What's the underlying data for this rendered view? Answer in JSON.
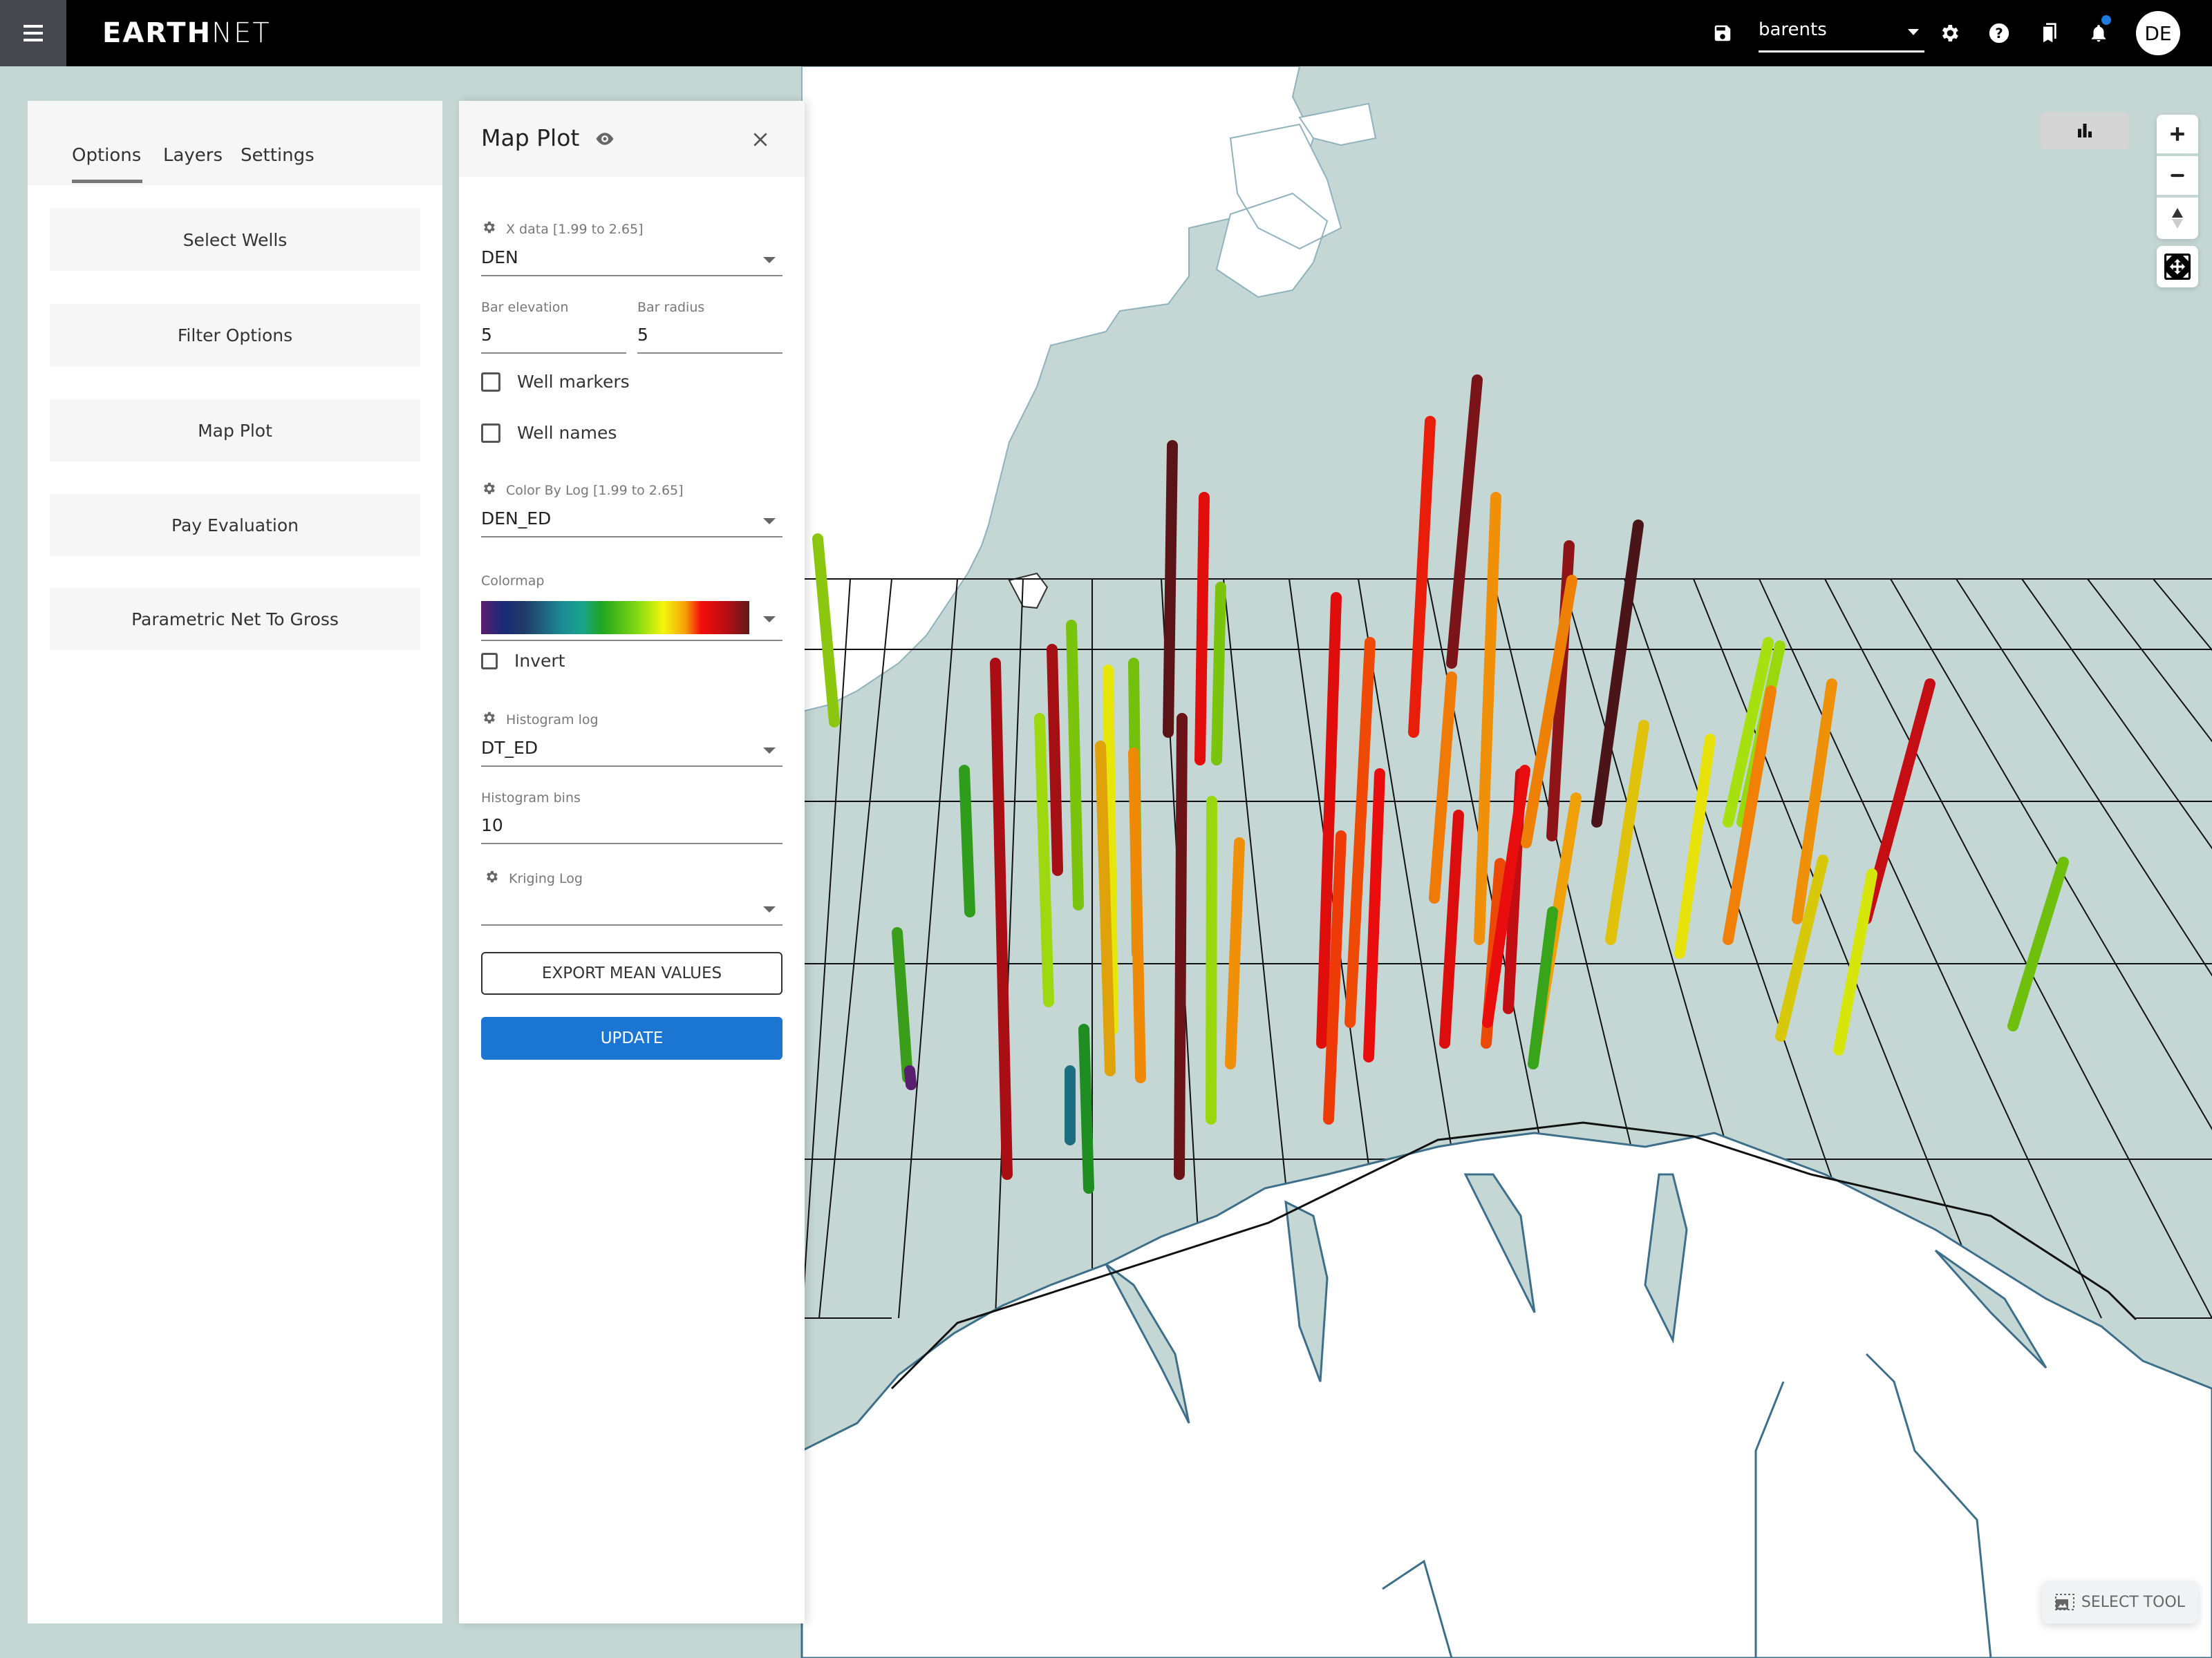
{
  "app": {
    "logo_bold": "EARTH",
    "logo_light": "NET"
  },
  "topbar": {
    "project": "barents",
    "icons": [
      "menu-icon",
      "save-icon",
      "settings-icon",
      "help-icon",
      "bookmarks-icon",
      "notifications-icon"
    ],
    "notifications_badge": true,
    "avatar_initials": "DE"
  },
  "left_panel": {
    "tabs": [
      {
        "label": "Options",
        "active": true
      },
      {
        "label": "Layers",
        "active": false
      },
      {
        "label": "Settings",
        "active": false
      }
    ],
    "buttons": [
      {
        "label": "Select Wells"
      },
      {
        "label": "Filter Options"
      },
      {
        "label": "Map Plot"
      },
      {
        "label": "Pay Evaluation"
      },
      {
        "label": "Parametric Net To Gross"
      }
    ]
  },
  "map_plot": {
    "title": "Map Plot",
    "x_data": {
      "label": "X data [1.99 to 2.65]",
      "value": "DEN"
    },
    "bar_elevation": {
      "label": "Bar elevation",
      "value": "5"
    },
    "bar_radius": {
      "label": "Bar radius",
      "value": "5"
    },
    "well_markers": {
      "label": "Well markers",
      "checked": false
    },
    "well_names": {
      "label": "Well names",
      "checked": false
    },
    "color_by_log": {
      "label": "Color By Log [1.99 to 2.65]",
      "value": "DEN_ED"
    },
    "colormap": {
      "label": "Colormap",
      "value": "rainbow-purple-to-darkred"
    },
    "invert": {
      "label": "Invert",
      "checked": false
    },
    "histogram_log": {
      "label": "Histogram log",
      "value": "DT_ED"
    },
    "histogram_bins": {
      "label": "Histogram bins",
      "value": "10"
    },
    "kriging_log": {
      "label": "Kriging Log",
      "value": ""
    },
    "export_button": "EXPORT MEAN VALUES",
    "update_button": "UPDATE"
  },
  "map": {
    "controls": [
      "histogram-toggle",
      "zoom-in",
      "zoom-out",
      "reset-north",
      "fullscreen"
    ],
    "select_tool_label": "SELECT TOOL",
    "colors": {
      "sea": "#c5d7d4",
      "land": "#ffffff",
      "coast": "#3d6f8a",
      "primary": "#1b76d2"
    },
    "wells": [
      {
        "color": "#8bc70f"
      },
      {
        "color": "#2f9c1c"
      },
      {
        "color": "#3a9e1a"
      },
      {
        "color": "#a80e13"
      },
      {
        "color": "#a40f14"
      },
      {
        "color": "#7ac40c"
      },
      {
        "color": "#9ed80e"
      },
      {
        "color": "#e6e60a"
      },
      {
        "color": "#74c00c"
      },
      {
        "color": "#e0a20a"
      },
      {
        "color": "#ee8a06"
      },
      {
        "color": "#1e8e22"
      },
      {
        "color": "#5a1418"
      },
      {
        "color": "#e20d0d"
      },
      {
        "color": "#7ac40c"
      },
      {
        "color": "#6a1418"
      },
      {
        "color": "#f09008"
      },
      {
        "color": "#9ad80e"
      },
      {
        "color": "#e00d0d"
      },
      {
        "color": "#ee4a06"
      },
      {
        "color": "#e81d0a"
      },
      {
        "color": "#7a1418"
      },
      {
        "color": "#ea0d0d"
      },
      {
        "color": "#f07a06"
      },
      {
        "color": "#c20e13"
      },
      {
        "color": "#ea4a06"
      },
      {
        "color": "#f09008"
      },
      {
        "color": "#8e1418"
      },
      {
        "color": "#ee8006"
      },
      {
        "color": "#4a1418"
      },
      {
        "color": "#e0c20a"
      },
      {
        "color": "#e6e20a"
      },
      {
        "color": "#a6e00e"
      },
      {
        "color": "#9ad80e"
      },
      {
        "color": "#f08006"
      },
      {
        "color": "#ee9008"
      },
      {
        "color": "#c40e13"
      },
      {
        "color": "#d8c80a"
      },
      {
        "color": "#d6e60a"
      },
      {
        "color": "#6ec00c"
      },
      {
        "color": "#ea0d0d"
      },
      {
        "color": "#ee3a06"
      },
      {
        "color": "#dc0d0d"
      },
      {
        "color": "#f0a008"
      },
      {
        "color": "#38a41a"
      },
      {
        "color": "#1b6e80"
      },
      {
        "color": "#5a1e6e"
      }
    ]
  }
}
